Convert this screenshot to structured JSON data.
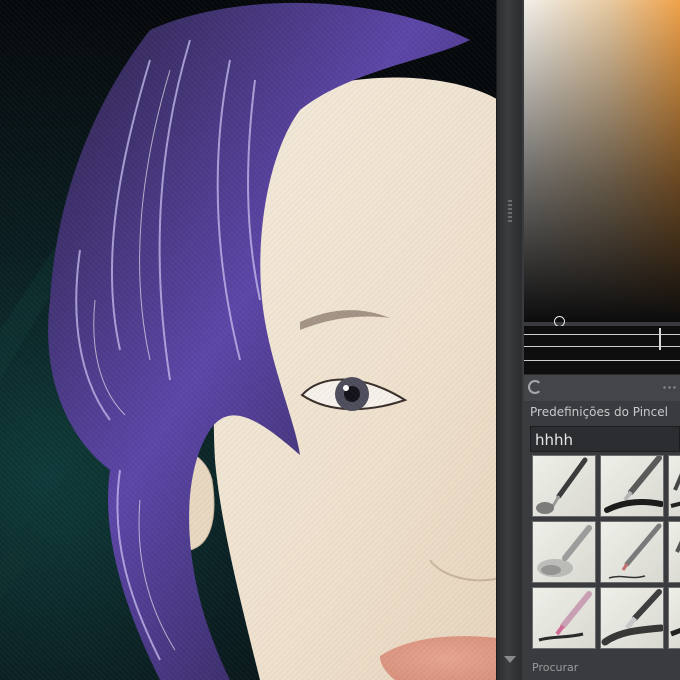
{
  "app": {
    "canvas_label": "painting canvas",
    "accent": "#f0a24a"
  },
  "color_selector": {
    "cursor_icon": "color-picker-ring-icon"
  },
  "toolbar": {
    "rotate_icon": "rotate-icon",
    "more_icon": "more-dots-icon"
  },
  "brush_presets": {
    "title": "Predefinições do Pincel",
    "tag_value": "hhhh",
    "search_label": "Procurar",
    "presets": [
      {
        "icon": "ink-pen-icon"
      },
      {
        "icon": "marker-brush-icon"
      },
      {
        "icon": "edge-brush-icon"
      },
      {
        "icon": "airbrush-icon"
      },
      {
        "icon": "pencil-icon"
      },
      {
        "icon": "partial-brush-icon"
      },
      {
        "icon": "pink-marker-icon"
      },
      {
        "icon": "paint-brush-icon"
      },
      {
        "icon": "partial-brush-icon"
      }
    ]
  }
}
